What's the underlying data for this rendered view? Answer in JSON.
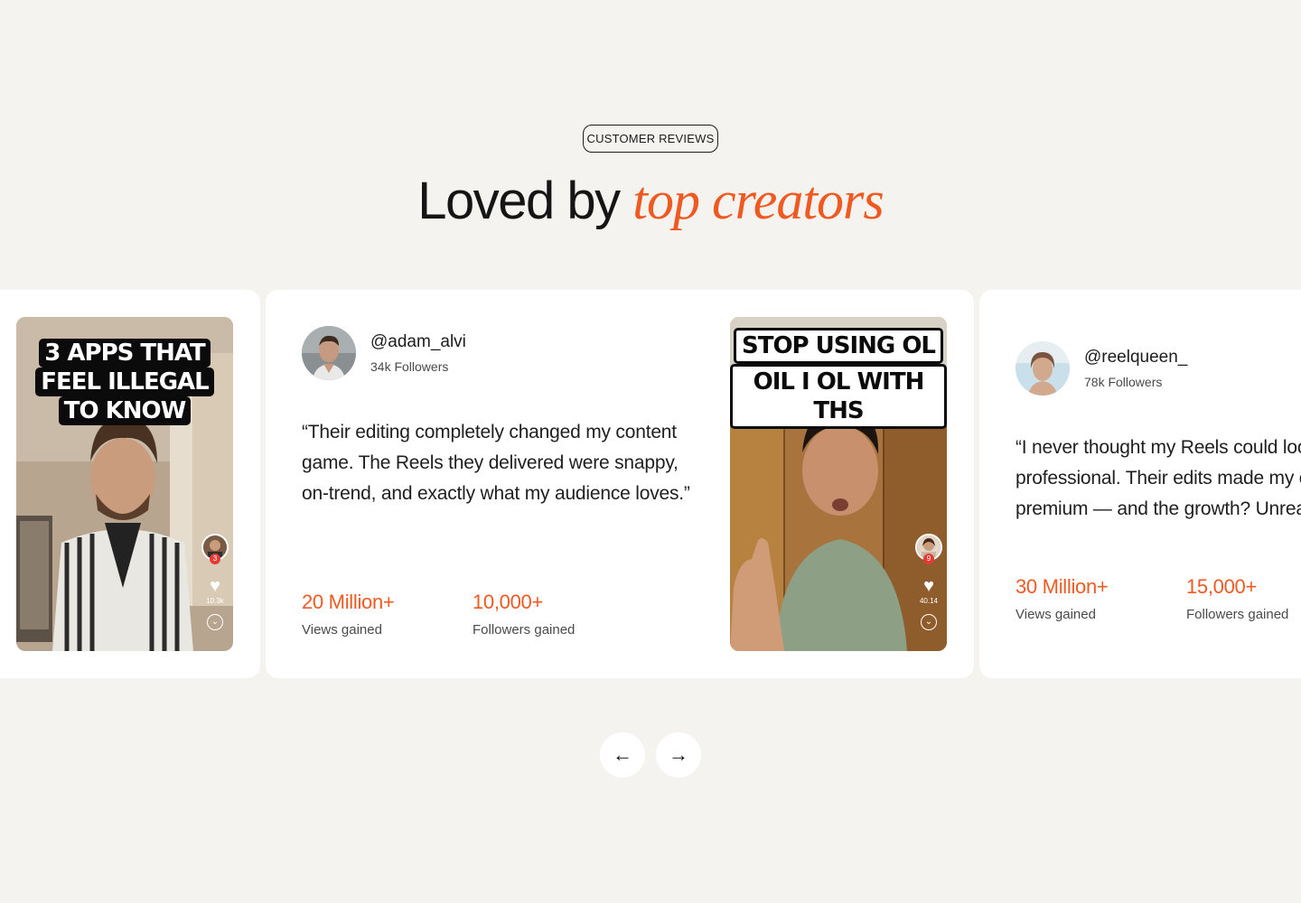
{
  "section": {
    "tag": "CUSTOMER REVIEWS",
    "heading_plain": "Loved by",
    "heading_accent": "top creators"
  },
  "colors": {
    "accent": "#ef5a23",
    "background": "#f4f3ef",
    "card": "#ffffff"
  },
  "cards": [
    {
      "video_caption": [
        "3 APPS THAT",
        "FEEL ILLEGAL",
        "TO KNOW"
      ],
      "badge": "3",
      "likes": "10.3k"
    },
    {
      "handle": "@adam_alvi",
      "followers": "34k Followers",
      "quote": "“Their editing completely changed my content game. The Reels they delivered were snappy, on-trend, and exactly what my audience loves.”",
      "stats": [
        {
          "value": "20 Million+",
          "label": "Views gained"
        },
        {
          "value": "10,000+",
          "label": "Followers gained"
        }
      ],
      "video_caption": [
        "STOP USING OL",
        "OIL I OL WITH THS"
      ],
      "badge": "9",
      "likes": "40.14"
    },
    {
      "handle": "@reelqueen_",
      "followers": "78k Followers",
      "quote": "“I never thought my Reels could look this professional. Their edits made my content feel premium — and the growth? Unreal.”",
      "stats": [
        {
          "value": "30 Million+",
          "label": "Views gained"
        },
        {
          "value": "15,000+",
          "label": "Followers gained"
        }
      ]
    }
  ],
  "nav": {
    "prev_icon": "arrow-left-icon",
    "next_icon": "arrow-right-icon",
    "prev": "←",
    "next": "→"
  }
}
